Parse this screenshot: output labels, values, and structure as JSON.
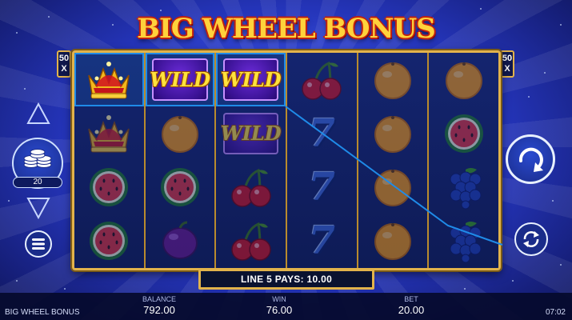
{
  "title": "BIG WHEEL BONUS",
  "multipliers": {
    "left": "50\nX",
    "right": "50\nX"
  },
  "reels": [
    [
      "crown",
      "crown",
      "watermelon",
      "watermelon"
    ],
    [
      "wild",
      "orange",
      "watermelon",
      "plum"
    ],
    [
      "wild",
      "wild",
      "cherry",
      "cherry"
    ],
    [
      "cherry",
      "seven",
      "seven",
      "seven"
    ],
    [
      "orange",
      "orange",
      "orange",
      "orange"
    ],
    [
      "orange",
      "watermelon",
      "grapes",
      "grapes"
    ]
  ],
  "highlighted_cells": [
    [
      0,
      0
    ],
    [
      1,
      0
    ],
    [
      2,
      0
    ]
  ],
  "wild_label": "WILD",
  "seven_label": "7",
  "win_message": "LINE 5 PAYS: 10.00",
  "bet_level": "20",
  "bottom": {
    "game_name": "BIG WHEEL BONUS",
    "balance_label": "BALANCE",
    "balance_value": "792.00",
    "win_label": "WIN",
    "win_value": "76.00",
    "bet_label": "BET",
    "bet_value": "20.00",
    "clock": "07:02"
  },
  "colors": {
    "frame_gold": "#e2b34b",
    "payline_blue": "#1f8be8",
    "background_blue": "#2434b8"
  },
  "icons": {
    "bet_up": "triangle-up-icon",
    "bet_down": "triangle-down-icon",
    "coins": "coin-stack-icon",
    "menu": "hamburger-menu-icon",
    "spin": "spin-arrow-icon",
    "autoplay": "autoplay-arrows-icon"
  }
}
